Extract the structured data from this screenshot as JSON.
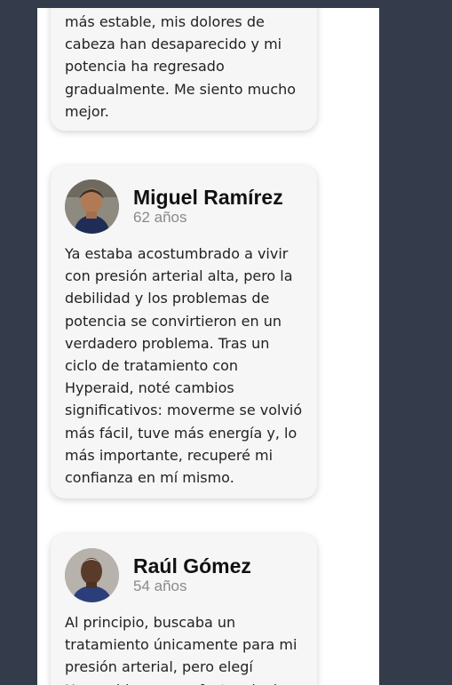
{
  "testimonials": [
    {
      "text": "más estable, mis dolores de cabeza han desaparecido y mi potencia ha regresado gradualmente. Me siento mucho mejor."
    },
    {
      "name": "Miguel Ramírez",
      "age": "62 años",
      "avatar_icon": "person-photo",
      "text": "Ya estaba acostumbrado a vivir con presión arterial alta, pero la debilidad y los problemas de potencia se convirtieron en un verdadero problema. Tras un ciclo de tratamiento con Hyperaid, noté cambios significativos: moverme se volvió más fácil, tuve más energía y, lo más importante, recuperé mi confianza en mí mismo."
    },
    {
      "name": "Raúl Gómez",
      "age": "54 años",
      "avatar_icon": "person-photo",
      "text": "Al principio, buscaba un tratamiento únicamente para mi presión arterial, pero elegí Hyperaid por sus efectos duales"
    }
  ]
}
